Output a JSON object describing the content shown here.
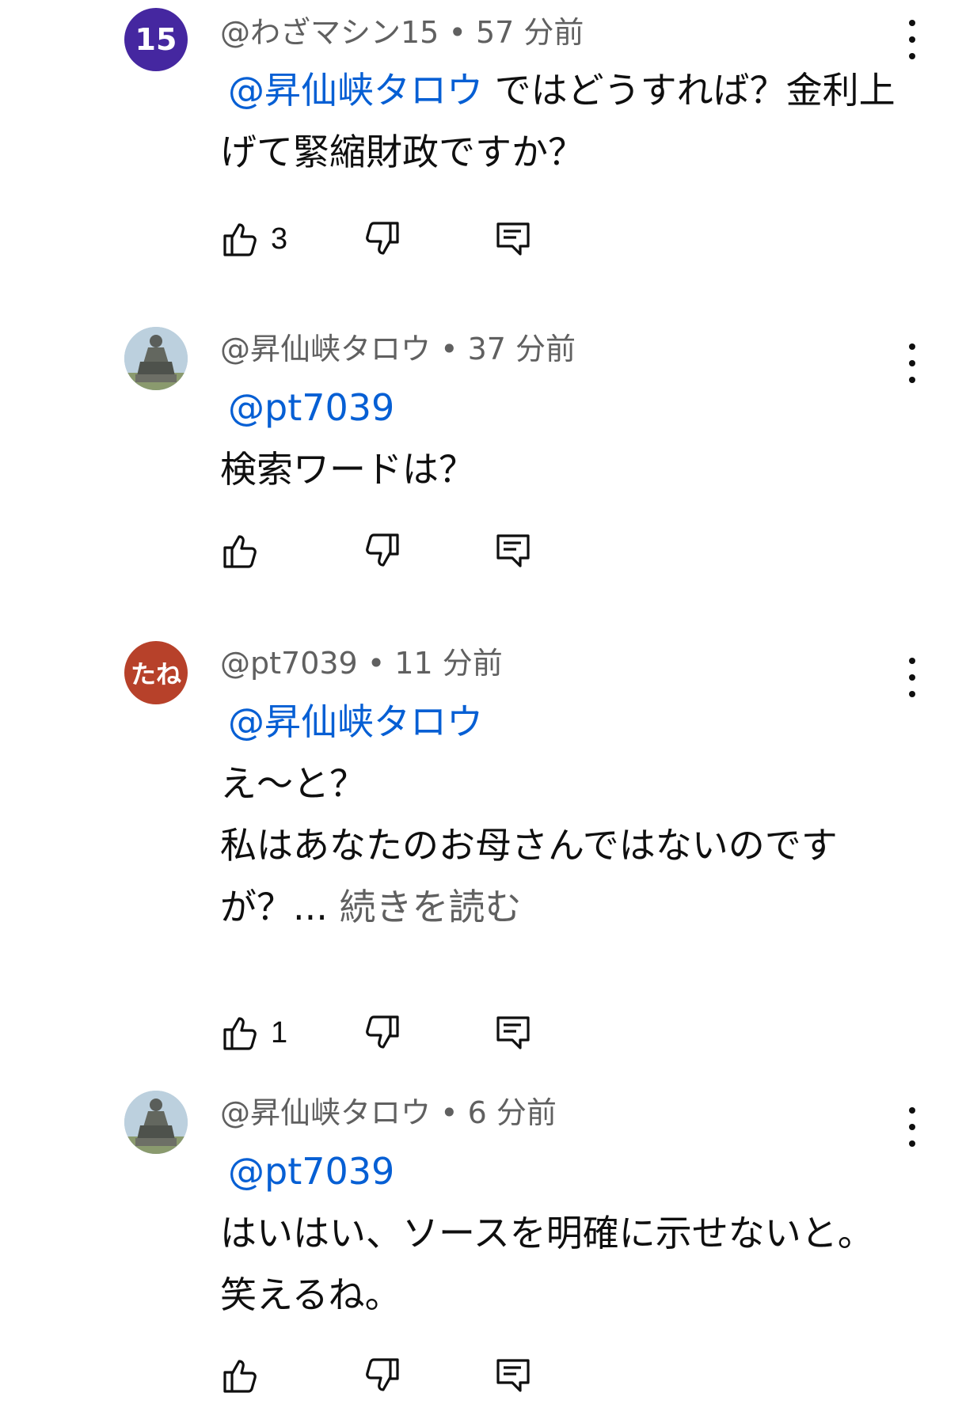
{
  "comments": [
    {
      "avatar_text": "15",
      "avatar_color": "#4527a0",
      "handle": "@わざマシン15",
      "sep": " • ",
      "time": "57 分前",
      "mention": "@昇仙峡タロウ",
      "lines": [
        "ではどうすれば？金利上",
        "げて緊縮財政ですか？"
      ],
      "likes": "3"
    },
    {
      "avatar_text": "",
      "avatar_kind": "statue-photo",
      "handle": "@昇仙峡タロウ",
      "sep": " • ",
      "time": "37 分前",
      "mention": "@pt7039",
      "lines": [
        "検索ワードは？"
      ],
      "likes": ""
    },
    {
      "avatar_text": "たね",
      "avatar_color": "#b7412a",
      "handle": "@pt7039",
      "sep": " • ",
      "time": "11 分前",
      "mention": "@昇仙峡タロウ",
      "lines": [
        "え〜と？",
        "私はあなたのお母さんではないのです",
        "が？... "
      ],
      "read_more": "続きを読む",
      "likes": "1"
    },
    {
      "avatar_text": "",
      "avatar_kind": "statue-photo",
      "handle": "@昇仙峡タロウ",
      "sep": " • ",
      "time": "6 分前",
      "mention": "@pt7039",
      "lines": [
        "はいはい、ソースを明確に示せないと。",
        "笑えるね。"
      ],
      "likes": ""
    }
  ],
  "icons": {
    "like": "thumbs-up-icon",
    "dislike": "thumbs-down-icon",
    "reply": "reply-comment-icon",
    "more": "more-vertical-icon"
  },
  "colors": {
    "mention": "#065fd4",
    "meta": "#606060",
    "text": "#0f0f0f"
  }
}
